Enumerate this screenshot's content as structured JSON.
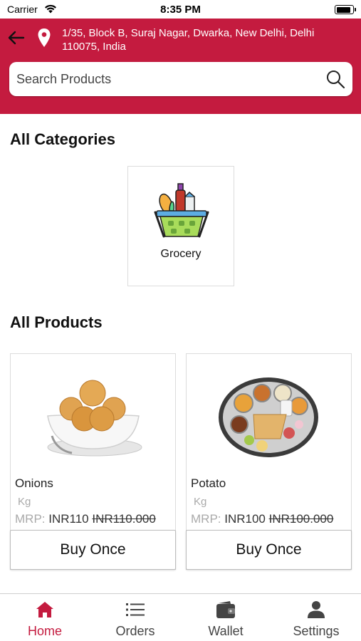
{
  "status_bar": {
    "carrier": "Carrier",
    "time": "8:35 PM",
    "battery_level": 0.95
  },
  "header": {
    "address": "1/35, Block B, Suraj Nagar, Dwarka, New Delhi, Delhi 110075, India",
    "back_icon": "arrow-left-icon",
    "location_icon": "map-pin-icon",
    "background_color": "#c41b3f"
  },
  "search": {
    "placeholder": "Search Products",
    "value": "",
    "icon": "search-icon"
  },
  "categories": {
    "title": "All Categories",
    "items": [
      {
        "label": "Grocery",
        "icon": "grocery-basket-icon"
      }
    ]
  },
  "products": {
    "title": "All Products",
    "items": [
      {
        "name": "Onions",
        "unit": "Kg",
        "mrp_label": "MRP:",
        "price": "INR110",
        "old_price": "INR110.000",
        "button": "Buy Once",
        "image": "laddoo-bowl-image"
      },
      {
        "name": "Potato",
        "unit": "Kg",
        "mrp_label": "MRP:",
        "price": "INR100",
        "old_price": "INR100.000",
        "button": "Buy Once",
        "image": "thali-plate-image"
      }
    ]
  },
  "tab_bar": {
    "active_color": "#c41b3f",
    "tabs": [
      {
        "label": "Home",
        "icon": "home-icon",
        "active": true
      },
      {
        "label": "Orders",
        "icon": "list-icon",
        "active": false
      },
      {
        "label": "Wallet",
        "icon": "wallet-icon",
        "active": false
      },
      {
        "label": "Settings",
        "icon": "user-icon",
        "active": false
      }
    ]
  }
}
